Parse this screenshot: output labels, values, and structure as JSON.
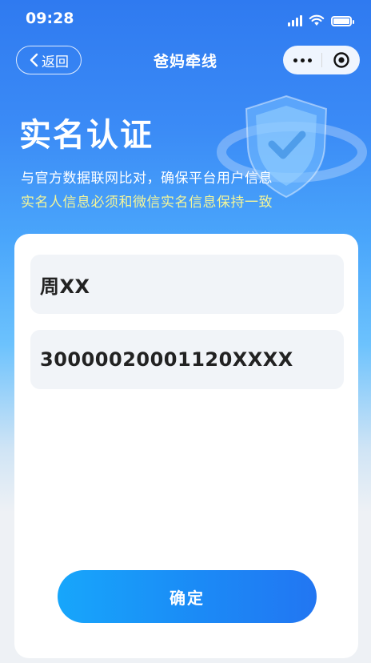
{
  "status_bar": {
    "time": "09:28"
  },
  "nav": {
    "back_label": "返回",
    "title": "爸妈牵线"
  },
  "hero": {
    "title": "实名认证",
    "description": "与官方数据联网比对，确保平台用户信息",
    "note": "实名人信息必须和微信实名信息保持一致"
  },
  "form": {
    "name_value": "周XX",
    "id_value": "30000020001120XXXX",
    "confirm_label": "确定"
  },
  "colors": {
    "primary": "#2f7af0",
    "note_yellow": "#f3f59a",
    "field_bg": "#f1f4f8",
    "button_start": "#17a6fb",
    "button_end": "#2276f2"
  },
  "icons": {
    "back": "chevron-left-icon",
    "more": "more-dots-icon",
    "target": "target-icon",
    "shield": "shield-check-icon"
  }
}
